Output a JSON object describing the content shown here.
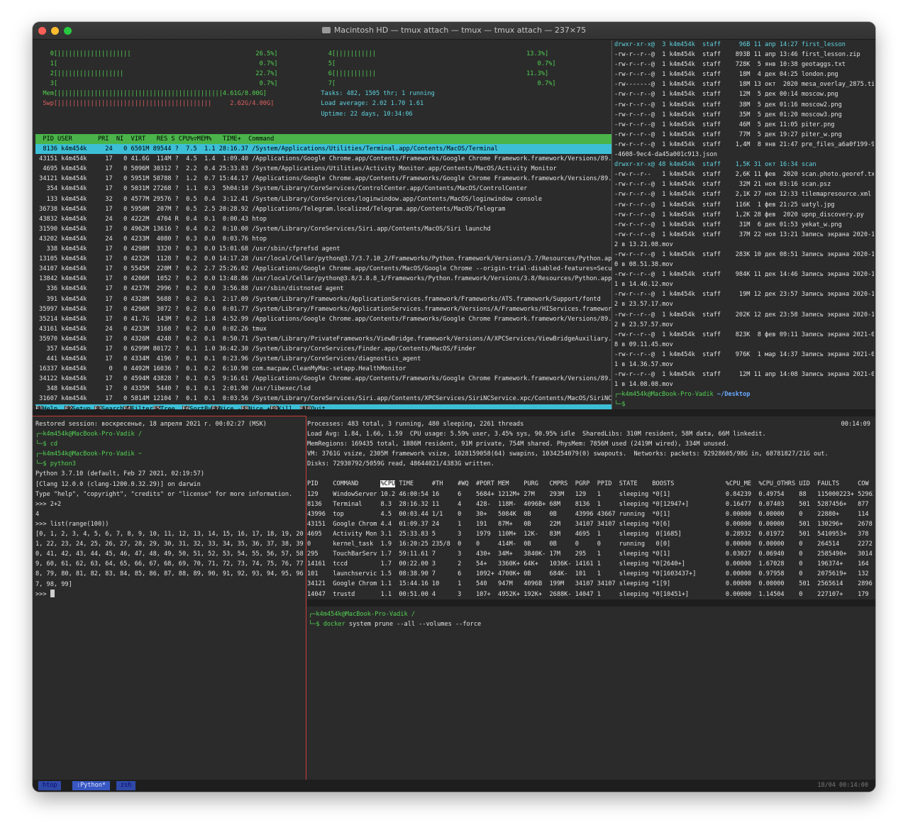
{
  "window": {
    "title": "Macintosh HD — tmux attach — tmux — tmux attach — 237×75"
  },
  "htop": {
    "meters_left": [
      "    0[||||||||||||||||||||                                  26.5%]",
      "    1[                                                       0.7%]",
      "    2[||||||||||||||||||                                    22.7%]",
      "    3[                                                       0.7%]",
      "  Mem[|||||||||||||||||||||||||||||||||||||||||||||4.61G/8.00G]",
      "  Swp[||||||||||||||||||||||||||||||||||||||||||     2.62G/4.00G]"
    ],
    "meters_right": [
      "    4[|||||||||||                                         13.3%]",
      "    5[                                                       0.7%]",
      "    6[|||||||||||                                         11.3%]",
      "    7[                                                       0.7%]",
      "  Tasks: 482, 1505 thr; 1 running",
      "  Load average: 2.02 1.70 1.61",
      "  Uptime: 22 days, 10:34:06"
    ],
    "header": "  PID USER       PRI  NI  VIRT   RES S CPU%▽MEM%   TIME+  Command",
    "rows": [
      "  8136 k4m454k     24   0 6501M 89544 ?  7.5  1.1 28:16.37 /System/Applications/Utilities/Terminal.app/Contents/MacOS/Terminal",
      " 43151 k4m454k     17   0 41.6G  114M ?  4.5  1.4  1:09.40 /Applications/Google Chrome.app/Contents/Frameworks/Google Chrome Framework.framework/Versions/89.0.4389.1",
      "  4695 k4m454k     17   0 5096M 30312 ?  2.2  0.4 25:33.83 /System/Applications/Utilities/Activity Monitor.app/Contents/MacOS/Activity Monitor",
      " 34121 k4m454k     17   0 5951M 58788 ?  1.2  0.7 15:44.17 /Applications/Google Chrome.app/Contents/Frameworks/Google Chrome Framework.framework/Versions/89.0.4389.1",
      "   354 k4m454k     17   0 5031M 27268 ?  1.1  0.3  5h04:10 /System/Library/CoreServices/ControlCenter.app/Contents/MacOS/ControlCenter",
      "   133 k4m454k     32   0 4577M 29576 ?  0.5  0.4  3:12.41 /System/Library/CoreServices/loginwindow.app/Contents/MacOS/loginwindow console",
      " 36738 k4m454k     17   0 5950M  207M ?  0.5  2.5 20:28.92 /Applications/Telegram.localized/Telegram.app/Contents/MacOS/Telegram",
      " 43832 k4m454k     24   0 4222M  4704 R  0.4  0.1  0:00.43 htop",
      " 31590 k4m454k     17   0 4962M 13616 ?  0.4  0.2  0:10.00 /System/Library/CoreServices/Siri.app/Contents/MacOS/Siri launchd",
      " 43202 k4m454k     24   0 4233M  4080 ?  0.3  0.0  0:03.76 htop",
      "   338 k4m454k     17   0 4298M  3320 ?  0.3  0.0 15:01.68 /usr/sbin/cfprefsd agent",
      " 13105 k4m454k     17   0 4232M  1128 ?  0.2  0.0 14:17.28 /usr/local/Cellar/python@3.7/3.7.10_2/Frameworks/Python.framework/Versions/3.7/Resources/Python.app/Conten",
      " 34107 k4m454k     17   0 5545M  220M ?  0.2  2.7 25:26.02 /Applications/Google Chrome.app/Contents/MacOS/Google Chrome --origin-trial-disabled-features=SecurePaymen",
      " 13842 k4m454k     17   0 4206M  1052 ?  0.2  0.0 13:48.86 /usr/local/Cellar/python@3.8/3.8.8_1/Frameworks/Python.framework/Versions/3.8/Resources/Python.app/Content",
      "   336 k4m454k     17   0 4237M  2996 ?  0.2  0.0  3:56.88 /usr/sbin/distnoted agent",
      "   391 k4m454k     17   0 4328M  5688 ?  0.2  0.1  2:17.09 /System/Library/Frameworks/ApplicationServices.framework/Frameworks/ATS.framework/Support/fontd",
      " 35997 k4m454k     17   0 4296M  3072 ?  0.2  0.0  0:01.77 /System/Library/Frameworks/ApplicationServices.framework/Versions/A/Frameworks/HIServices.framework/Versio",
      " 35214 k4m454k     17   0 41.7G  143M ?  0.2  1.8  4:52.99 /Applications/Google Chrome.app/Contents/Frameworks/Google Chrome Framework.framework/Versions/89.0.4389.1",
      " 43161 k4m454k     24   0 4233M  3168 ?  0.2  0.0  0:02.26 tmux",
      " 35970 k4m454k     17   0 4326M  4248 ?  0.2  0.1  0:50.71 /System/Library/PrivateFrameworks/ViewBridge.framework/Versions/A/XPCServices/ViewBridgeAuxiliary.xpc/Cont",
      "   357 k4m454k     17   0 6299M 80172 ?  0.1  1.0 36:42.30 /System/Library/CoreServices/Finder.app/Contents/MacOS/Finder",
      "   441 k4m454k     17   0 4334M  4196 ?  0.1  0.1  0:23.96 /System/Library/CoreServices/diagnostics_agent",
      " 16337 k4m454k      0   0 4492M 16036 ?  0.1  0.2  6:10.90 com.macpaw.CleanMyMac-setapp.HealthMonitor",
      " 34122 k4m454k     17   0 4594M 43828 ?  0.1  0.5  9:16.61 /Applications/Google Chrome.app/Contents/Frameworks/Google Chrome Framework.framework/Versions/89.0.4389.1",
      "   348 k4m454k     17   0 4335M  5440 ?  0.1  0.1  2:01.90 /usr/libexec/lsd",
      " 31607 k4m454k     17   0 5814M 12104 ?  0.1  0.1  0:03.56 /System/Library/CoreServices/Siri.app/Contents/XPCServices/SiriNCService.xpc/Contents/MacOS/SiriNCService"
    ],
    "fkeys": [
      {
        "k": "F1",
        "l": "Help  "
      },
      {
        "k": "F2",
        "l": "Setup "
      },
      {
        "k": "F3",
        "l": "Search"
      },
      {
        "k": "F4",
        "l": "Filter"
      },
      {
        "k": "F5",
        "l": "Tree  "
      },
      {
        "k": "F6",
        "l": "SortBy"
      },
      {
        "k": "F7",
        "l": "Nice -"
      },
      {
        "k": "F8",
        "l": "Nice +"
      },
      {
        "k": "F9",
        "l": "Kill  "
      },
      {
        "k": "F10",
        "l": "Quit"
      }
    ]
  },
  "ls": {
    "lines": [
      "drwxr-xr-x@  3 k4m454k  staff     96B 11 апр 14:27 first_lesson",
      "-rw-r--r--@  1 k4m454k  staff    893B 11 апр 13:46 first_lesson.zip",
      "-rw-r--r--@  1 k4m454k  staff    728K  5 янв 10:38 geotaggs.txt",
      "-rw-r--r--@  1 k4m454k  staff     18M  4 дек 04:25 london.png",
      "-rw-------@  1 k4m454k  staff     18M 13 окт  2020 mesa_overlay_2875.tif",
      "-rw-r--r--@  1 k4m454k  staff     12M  5 дек 00:14 moscow.png",
      "-rw-r--r--@  1 k4m454k  staff     38M  5 дек 01:16 moscow2.png",
      "-rw-r--r--@  1 k4m454k  staff     35M  5 дек 01:20 moscow3.png",
      "-rw-r--r--@  1 k4m454k  staff     46M  5 дек 11:05 piter.png",
      "-rw-r--r--@  1 k4m454k  staff     77M  5 дек 19:27 piter_w.png",
      "-rw-r--r--@  1 k4m454k  staff    1,4M  8 янв 21:47 pre_files_a6a0f199-964f",
      "-4608-9ec4-da45a001c913.json",
      "drwxr-xr-x@ 48 k4m454k  staff    1,5K 31 окт 16:34 scan",
      "-rw-r--r--   1 k4m454k  staff    2,6K 11 фев  2020 scan.photo.georef.txt",
      "-rw-r--r--@  1 k4m454k  staff     32M 21 ноя 03:16 scan.psz",
      "-rw-r--r--@  1 k4m454k  staff    2,1K 27 ноя 12:33 tilemapresource.xml",
      "-rw-r--r--@  1 k4m454k  staff    116K  1 фев 21:25 uatyl.jpg",
      "-rw-r--r--@  1 k4m454k  staff    1,2K 28 фев  2020 upnp_discovery.py",
      "-rw-r--r--@  1 k4m454k  staff     31M  6 дек 01:53 yekat_w.png",
      "-rw-r--r--@  1 k4m454k  staff     37M 22 ноя 13:21 Запись экрана 2020-11-2",
      "2 в 13.21.08.mov",
      "-rw-r--r--@  1 k4m454k  staff    283K 10 дек 08:51 Запись экрана 2020-12-1",
      "0 в 08.51.38.mov",
      "-rw-r--r--@  1 k4m454k  staff    984K 11 дек 14:46 Запись экрана 2020-12-1",
      "1 в 14.46.12.mov",
      "-rw-r--r--@  1 k4m454k  staff     19M 12 дек 23:57 Запись экрана 2020-12-1",
      "2 в 23.57.17.mov",
      "-rw-r--r--@  1 k4m454k  staff    202K 12 дек 23:58 Запись экрана 2020-12-1",
      "2 в 23.57.57.mov",
      "-rw-r--r--@  1 k4m454k  staff    823K  8 фев 09:11 Запись экрана 2021-02-0",
      "8 в 09.11.45.mov",
      "-rw-r--r--@  1 k4m454k  staff    976K  1 мар 14:37 Запись экрана 2021-03-0",
      "1 в 14.36.57.mov",
      "-rw-r--r--@  1 k4m454k  staff     12M 11 апр 14:08 Запись экрана 2021-04-1",
      "1 в 14.08.08.mov"
    ],
    "prompt_user": "┌─k4m454k@MacBook-Pro-Vadik",
    "prompt_dir": "~/Desktop",
    "prompt_line2": "└─$"
  },
  "python": {
    "lines": [
      "Restored session: воскресенье, 18 апреля 2021 г. 00:02:27 (MSK)",
      "┌─k4m454k@MacBook-Pro-Vadik /",
      "└─$ cd",
      "┌─k4m454k@MacBook-Pro-Vadik ~",
      "└─$ python3",
      "Python 3.7.10 (default, Feb 27 2021, 02:19:57)",
      "[Clang 12.0.0 (clang-1200.0.32.29)] on darwin",
      "Type \"help\", \"copyright\", \"credits\" or \"license\" for more information.",
      ">>> 2+2",
      "4",
      ">>> list(range(100))",
      "[0, 1, 2, 3, 4, 5, 6, 7, 8, 9, 10, 11, 12, 13, 14, 15, 16, 17, 18, 19, 20, 2",
      "1, 22, 23, 24, 25, 26, 27, 28, 29, 30, 31, 32, 33, 34, 35, 36, 37, 38, 39, 4",
      "0, 41, 42, 43, 44, 45, 46, 47, 48, 49, 50, 51, 52, 53, 54, 55, 56, 57, 58, 5",
      "9, 60, 61, 62, 63, 64, 65, 66, 67, 68, 69, 70, 71, 72, 73, 74, 75, 76, 77, 7",
      "8, 79, 80, 81, 82, 83, 84, 85, 86, 87, 88, 89, 90, 91, 92, 93, 94, 95, 96, 9",
      "7, 98, 99]",
      ">>> "
    ]
  },
  "top": {
    "summary": [
      "Processes: 483 total, 3 running, 480 sleeping, 2261 threads",
      "Load Avg: 1.84, 1.66, 1.59  CPU usage: 5.59% user, 3.45% sys, 90.95% idle  SharedLibs: 310M resident, 58M data, 66M linkedit.",
      "MemRegions: 169435 total, 1886M resident, 91M private, 754M shared. PhysMem: 7856M used (2419M wired), 334M unused.",
      "VM: 3761G vsize, 2305M framework vsize, 1028159058(64) swapins, 1034254079(0) swapouts.  Networks: packets: 92928605/98G in, 68781827/21G out.",
      "Disks: 72930792/5059G read, 48644021/4383G written."
    ],
    "clock": "00:14:09",
    "header_pre": "PID    COMMAND      ",
    "header_sel": "%CPU",
    "header_post": " TIME     #TH    #WQ  #PORT MEM    PURG   CMPRS  PGRP  PPID  STATE    BOOSTS              %CPU_ME  %CPU_OTHRS UID  FAULTS     COW",
    "rows": [
      "129    WindowServer 10.2 46:00:54 16     6    5684+ 1212M+ 27M    293M   129   1     sleeping *0[1]               0.84239  0.49754    88   115000223+ 529634",
      "8136   Terminal     8.3  28:16.32 11     4    428-  118M-  4096B+ 68M    8136  1     sleeping *0[12947+]          0.16477  0.07403    501  5287456+   877",
      "43996  top          4.5  00:03.44 1/1    0    30+   5084K  0B     0B     43996 43667 running  *0[1]               0.00000  0.00000    0    22880+     114",
      "43151  Google Chrom 4.4  01:09.37 24     1    191   87M+   0B     22M    34107 34107 sleeping *0[6]               0.00000  0.00000    501  130296+    2678",
      "4695   Activity Mon 3.1  25:33.83 5      3    1979  110M+  12K-   83M    4695  1     sleeping  0[1685]            0.28932  0.01972    501  5410953+   378",
      "0      kernel_task  1.9  16:20:25 235/8  0    0     414M-  0B     0B     0     0     running   0[0]               0.00000  0.00000    0    264514     2272",
      "295    TouchBarServ 1.7  59:11.61 7      3    430+  34M+   3840K- 17M    295   1     sleeping *0[1]               0.03027  0.06940    0    2585490+   3014",
      "14161  tccd         1.7  00:22.00 3      2    54+   3360K+ 64K+   1036K- 14161 1     sleeping *0[2640+]           0.00000  1.67028    0    196374+    164",
      "101    launchservic 1.5  08:38.90 7      6    1092+ 4700K+ 0B     684K-  101   1     sleeping *0[1603437+]        0.00000  0.97958    0    2075619+   132",
      "34121  Google Chrom 1.1  15:44.16 10     1    540   947M   4096B  199M   34107 34107 sleeping *1[9]               0.00000  0.00000    501  2565614    2896",
      "14047  trustd       1.1  00:51.00 4      3    107+  4952K+ 192K+  2688K- 14047 1     sleeping *0[10451+]          0.00000  1.14504    0    227107+    179"
    ]
  },
  "zsh": {
    "prompt_user": "┌─k4m454k@MacBook-Pro-Vadik /",
    "prompt_marker": "└─$ ",
    "command_name": "docker",
    "command_args": " system prune --all --volumes --force"
  },
  "tmux": {
    "tabs": [
      " htop ",
      " :Python* ",
      " zsh "
    ],
    "date": "18/04",
    "time": "00:14:00"
  },
  "colors": {
    "green": "#52d152",
    "cyan": "#3cbfd6",
    "tab_active": "#3857c2",
    "pane_border_active": "#c83c3c"
  }
}
